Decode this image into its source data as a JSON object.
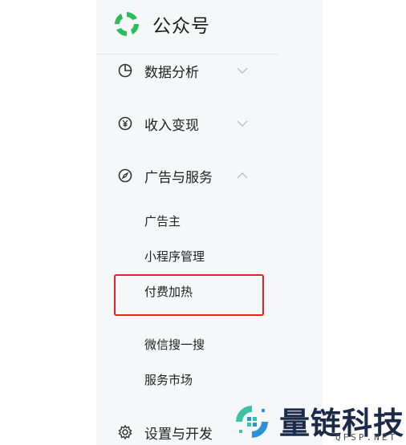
{
  "app": {
    "title": "公众号",
    "brand_color": "#2bbd5b"
  },
  "menu": [
    {
      "label": "数据分析",
      "icon": "pie-chart-icon",
      "expanded": false
    },
    {
      "label": "收入变现",
      "icon": "yen-icon",
      "expanded": false
    },
    {
      "label": "广告与服务",
      "icon": "compass-icon",
      "expanded": true
    },
    {
      "label": "设置与开发",
      "icon": "gear-icon",
      "expanded": false
    }
  ],
  "submenu": [
    "广告主",
    "小程序管理",
    "付费加热",
    "微信搜一搜",
    "服务市场"
  ],
  "highlight_color": "#e4211d",
  "watermark": {
    "name": "量链科技",
    "domain": "QFSP.NET"
  }
}
